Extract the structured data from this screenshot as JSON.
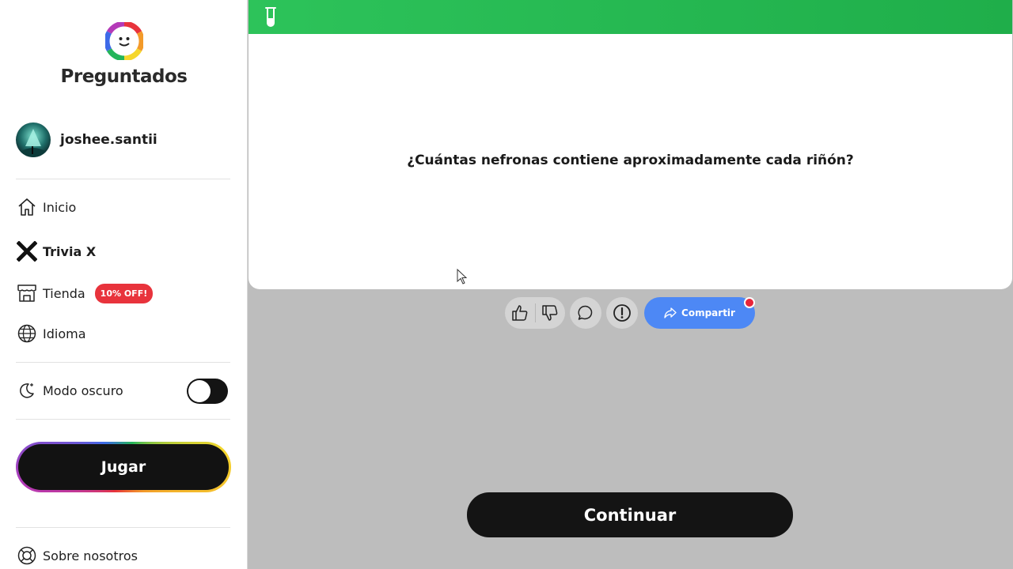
{
  "brand": {
    "name": "Preguntados",
    "logo_icon": "preguntados-logo-icon"
  },
  "profile": {
    "username": "joshee.santii",
    "avatar": "avatar"
  },
  "sidebar": {
    "items": [
      {
        "label": "Inicio",
        "icon": "home-icon"
      },
      {
        "label": "Trivia X",
        "icon": "x-icon"
      },
      {
        "label": "Tienda",
        "icon": "store-icon",
        "badge": "10% OFF!"
      },
      {
        "label": "Idioma",
        "icon": "globe-icon"
      }
    ],
    "dark_mode": {
      "label": "Modo oscuro",
      "icon": "moon-icon",
      "enabled": false
    },
    "play_label": "Jugar",
    "about": {
      "label": "Sobre nosotros",
      "icon": "lifebuoy-icon"
    }
  },
  "question": {
    "category_icon": "test-tube-icon",
    "category_color": "#2dc35a",
    "text": "¿Cuántas nefronas contiene aproximadamente cada riñón?"
  },
  "actions": {
    "like_icon": "thumbs-up-icon",
    "dislike_icon": "thumbs-down-icon",
    "comment_icon": "comment-icon",
    "report_icon": "alert-icon",
    "share_label": "Compartir",
    "share_icon": "share-icon"
  },
  "continue_label": "Continuar",
  "colors": {
    "accent_blue": "#4d88f5",
    "badge_red": "#e8333c",
    "dark": "#141414"
  }
}
